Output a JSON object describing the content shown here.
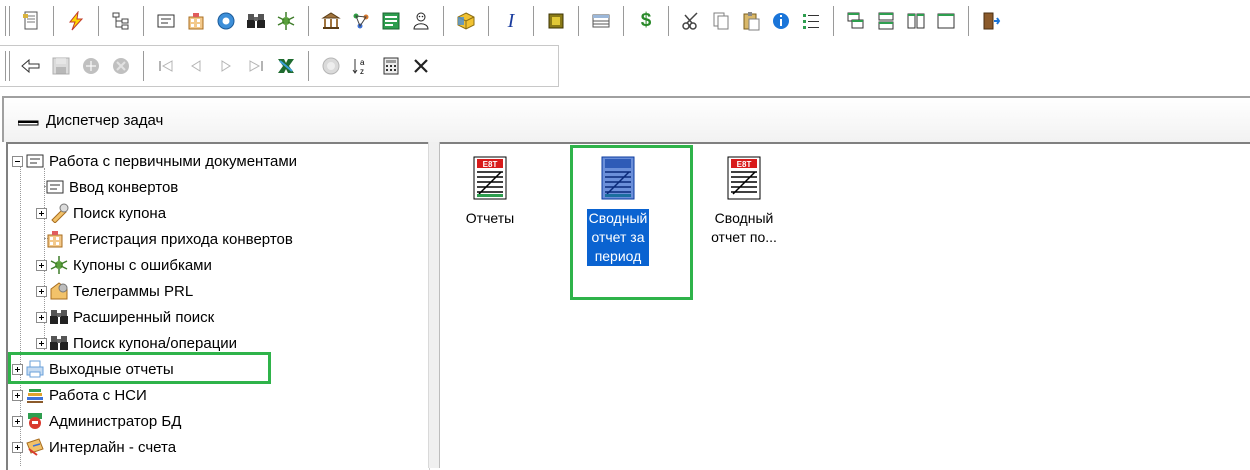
{
  "window": {
    "title": "Диспетчер задач"
  },
  "toolbar": {
    "row1_icons": [
      "document-icon",
      "lightning-icon",
      "tree-icon",
      "form-icon",
      "building-grid-icon",
      "globe-icon",
      "binoculars-icon",
      "bug-icon",
      "bank-icon",
      "graph-icon",
      "report-grid-icon",
      "user-icon",
      "cube-icon",
      "italic-icon",
      "chip-icon",
      "table-icon",
      "dollar-icon",
      "scissors-icon",
      "copy-icon",
      "paste-icon",
      "info-icon",
      "list-icon",
      "window-cascade-icon",
      "window-tile-horizontal-icon",
      "window-tile-vertical-icon",
      "window-icon",
      "exit-icon"
    ],
    "italic_label": "I",
    "dollar_label": "$",
    "row2_icons": [
      "back-icon",
      "save-icon",
      "add-icon",
      "delete-icon",
      "first-icon",
      "prev-icon",
      "next-icon",
      "last-icon",
      "excel-icon",
      "refresh-icon",
      "sort-icon",
      "calculator-icon",
      "close-icon"
    ]
  },
  "tree": {
    "items": [
      {
        "label": "Работа с первичными документами",
        "expanded": true,
        "level": 0
      },
      {
        "label": "Ввод конвертов",
        "level": 1
      },
      {
        "label": "Поиск купона",
        "level": 1,
        "expandable": true
      },
      {
        "label": "Регистрация прихода конвертов",
        "level": 1
      },
      {
        "label": "Купоны с ошибками",
        "level": 1,
        "expandable": true
      },
      {
        "label": "Телеграммы PRL",
        "level": 1,
        "expandable": true
      },
      {
        "label": "Расширенный поиск",
        "level": 1,
        "expandable": true
      },
      {
        "label": "Поиск купона/операции",
        "level": 1,
        "expandable": true
      },
      {
        "label": "Выходные отчеты",
        "level": 0,
        "expandable": true,
        "highlighted": true
      },
      {
        "label": "Работа с НСИ",
        "level": 0,
        "expandable": true
      },
      {
        "label": "Администратор БД",
        "level": 0,
        "expandable": true
      },
      {
        "label": "Интерлайн - счета",
        "level": 0,
        "expandable": true
      }
    ]
  },
  "list": {
    "items": [
      {
        "lines": [
          "Отчеты"
        ],
        "selected": false
      },
      {
        "lines": [
          "Сводный",
          "отчет за",
          "период"
        ],
        "selected": true,
        "highlighted": true
      },
      {
        "lines": [
          "Сводный",
          "отчет по..."
        ],
        "selected": false
      }
    ]
  },
  "colors": {
    "highlight_border": "#2fb34a",
    "selection": "#0a63d1"
  }
}
